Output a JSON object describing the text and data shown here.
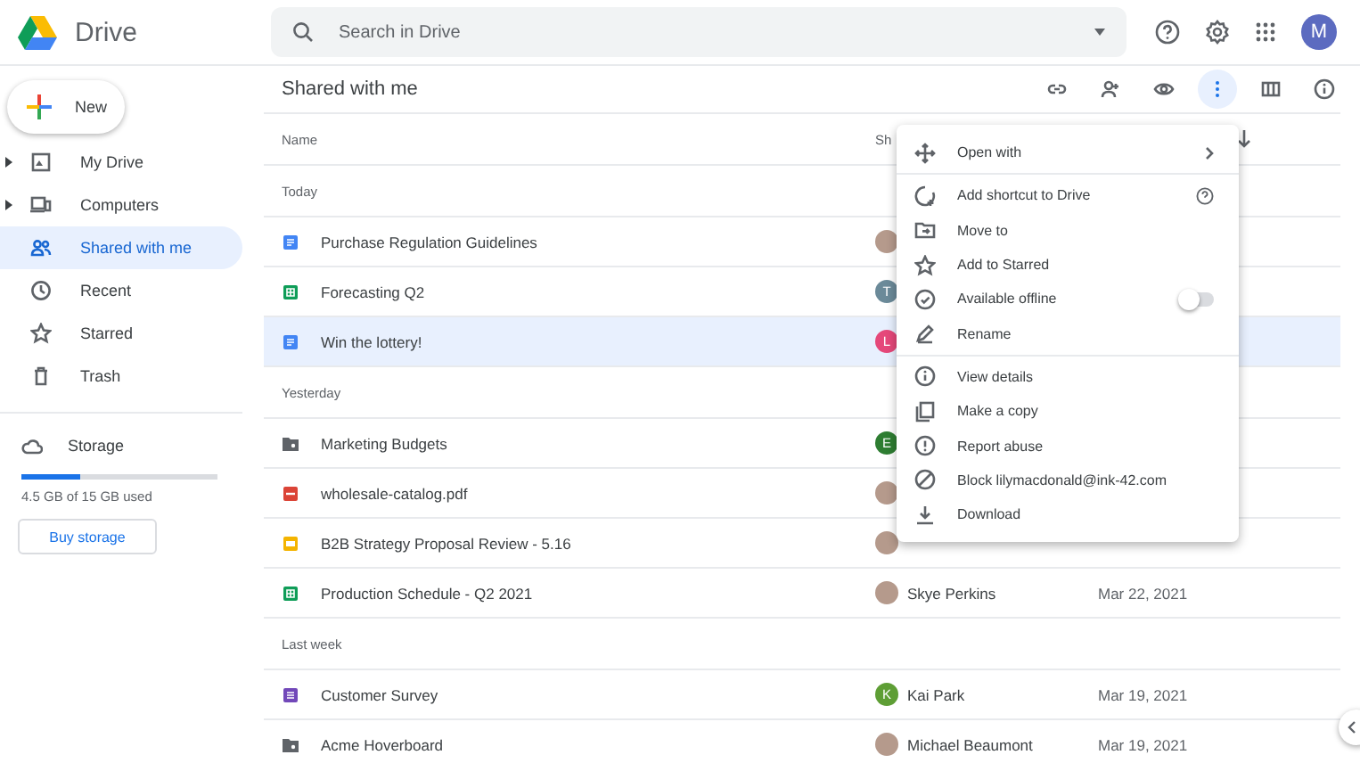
{
  "topbar": {
    "app_name": "Drive",
    "search": {
      "placeholder": "Search in Drive"
    },
    "account": {
      "letter": "M"
    }
  },
  "sidebar": {
    "new_button": "New",
    "items": [
      {
        "label": "My Drive",
        "expander": true,
        "selected": false
      },
      {
        "label": "Computers",
        "expander": true,
        "selected": false
      },
      {
        "label": "Shared with me",
        "expander": false,
        "selected": true
      },
      {
        "label": "Recent",
        "expander": false,
        "selected": false
      },
      {
        "label": "Starred",
        "expander": false,
        "selected": false
      },
      {
        "label": "Trash",
        "expander": false,
        "selected": false
      }
    ],
    "storage": {
      "label": "Storage",
      "level": 0.3,
      "usage": "4.5 GB of 15 GB used",
      "buy_button": "Buy storage"
    }
  },
  "main": {
    "title": "Shared with me",
    "toolbar": [
      {
        "pressed": false
      },
      {
        "pressed": false
      },
      {
        "pressed": false
      },
      {
        "pressed": true
      },
      {
        "pressed": false
      },
      {
        "pressed": false
      }
    ],
    "columns": {
      "column_1": "Name",
      "column_2": "Sh"
    },
    "sections": [
      {
        "title": "Today",
        "rows": [
          {
            "kind": "doc",
            "name": "Purchase Regulation Guidelines",
            "selected": false,
            "owner": {
              "kind": "photo"
            }
          },
          {
            "kind": "sheet",
            "name": "Forecasting Q2",
            "selected": false,
            "owner": {
              "kind": "letter",
              "letter": "T",
              "color": "#6b8a99"
            }
          },
          {
            "kind": "doc",
            "name": "Win the lottery!",
            "selected": true,
            "owner": {
              "kind": "letter",
              "letter": "L",
              "color": "#e5487a"
            }
          }
        ]
      },
      {
        "title": "Yesterday",
        "rows": [
          {
            "kind": "folder",
            "name": "Marketing Budgets",
            "selected": false,
            "owner": {
              "kind": "letter",
              "letter": "E",
              "color": "#2e7d32"
            }
          },
          {
            "kind": "pdf",
            "name": "wholesale-catalog.pdf",
            "selected": false,
            "owner": {
              "kind": "photo"
            }
          },
          {
            "kind": "slides",
            "name": "B2B Strategy Proposal Review - 5.16",
            "selected": false,
            "owner": {
              "kind": "photo"
            }
          },
          {
            "kind": "sheet",
            "name": "Production Schedule - Q2 2021",
            "selected": false,
            "owner": {
              "kind": "photo",
              "name": "Skye Perkins"
            },
            "modified": "Mar 22, 2021"
          }
        ]
      },
      {
        "title": "Last week",
        "rows": [
          {
            "kind": "form",
            "name": "Customer Survey",
            "selected": false,
            "owner": {
              "kind": "letter",
              "letter": "K",
              "color": "#5e9e35",
              "name": "Kai Park"
            },
            "modified": "Mar 19, 2021"
          },
          {
            "kind": "folder",
            "name": "Acme Hoverboard",
            "selected": false,
            "owner": {
              "kind": "photo",
              "name": "Michael Beaumont"
            },
            "modified": "Mar 19, 2021"
          }
        ]
      }
    ]
  },
  "context_menu": {
    "groups": [
      [
        {
          "kind": "submenu",
          "label": "Open with"
        }
      ],
      [
        {
          "kind": "help",
          "label": "Add shortcut to Drive"
        },
        {
          "kind": "plain",
          "label": "Move to"
        },
        {
          "kind": "plain",
          "label": "Add to Starred"
        },
        {
          "kind": "toggle",
          "label": "Available offline",
          "on": false
        },
        {
          "kind": "plain",
          "label": "Rename"
        }
      ],
      [
        {
          "kind": "plain",
          "label": "View details"
        },
        {
          "kind": "plain",
          "label": "Make a copy"
        },
        {
          "kind": "plain",
          "label": "Report abuse"
        },
        {
          "kind": "plain",
          "label": "Block lilymacdonald@ink-42.com"
        },
        {
          "kind": "plain",
          "label": "Download"
        }
      ]
    ]
  }
}
